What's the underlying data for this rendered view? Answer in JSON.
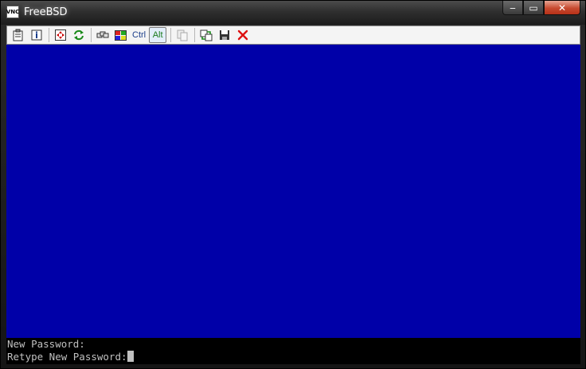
{
  "window": {
    "title": "FreeBSD",
    "app_icon_text": "VNC",
    "controls": {
      "close_glyph": "✕",
      "maximize_glyph": "▭",
      "minimize_glyph": "‒"
    }
  },
  "toolbar": {
    "items": [
      {
        "name": "options-icon"
      },
      {
        "name": "connection-info-icon"
      },
      {
        "name": "fullscreen-icon"
      },
      {
        "name": "refresh-icon"
      },
      {
        "name": "ctrl-alt-del-icon"
      },
      {
        "name": "start-menu-icon"
      },
      {
        "name": "ctrl-key",
        "label": "Ctrl"
      },
      {
        "name": "alt-key",
        "label": "Alt"
      },
      {
        "name": "copy-icon"
      },
      {
        "name": "file-transfer-icon"
      },
      {
        "name": "save-icon"
      },
      {
        "name": "disconnect-icon"
      }
    ],
    "ctrl_label": "Ctrl",
    "alt_label": "Alt"
  },
  "console": {
    "background": "#0000a8",
    "lines": [
      "New Password:",
      "Retype New Password:"
    ]
  }
}
